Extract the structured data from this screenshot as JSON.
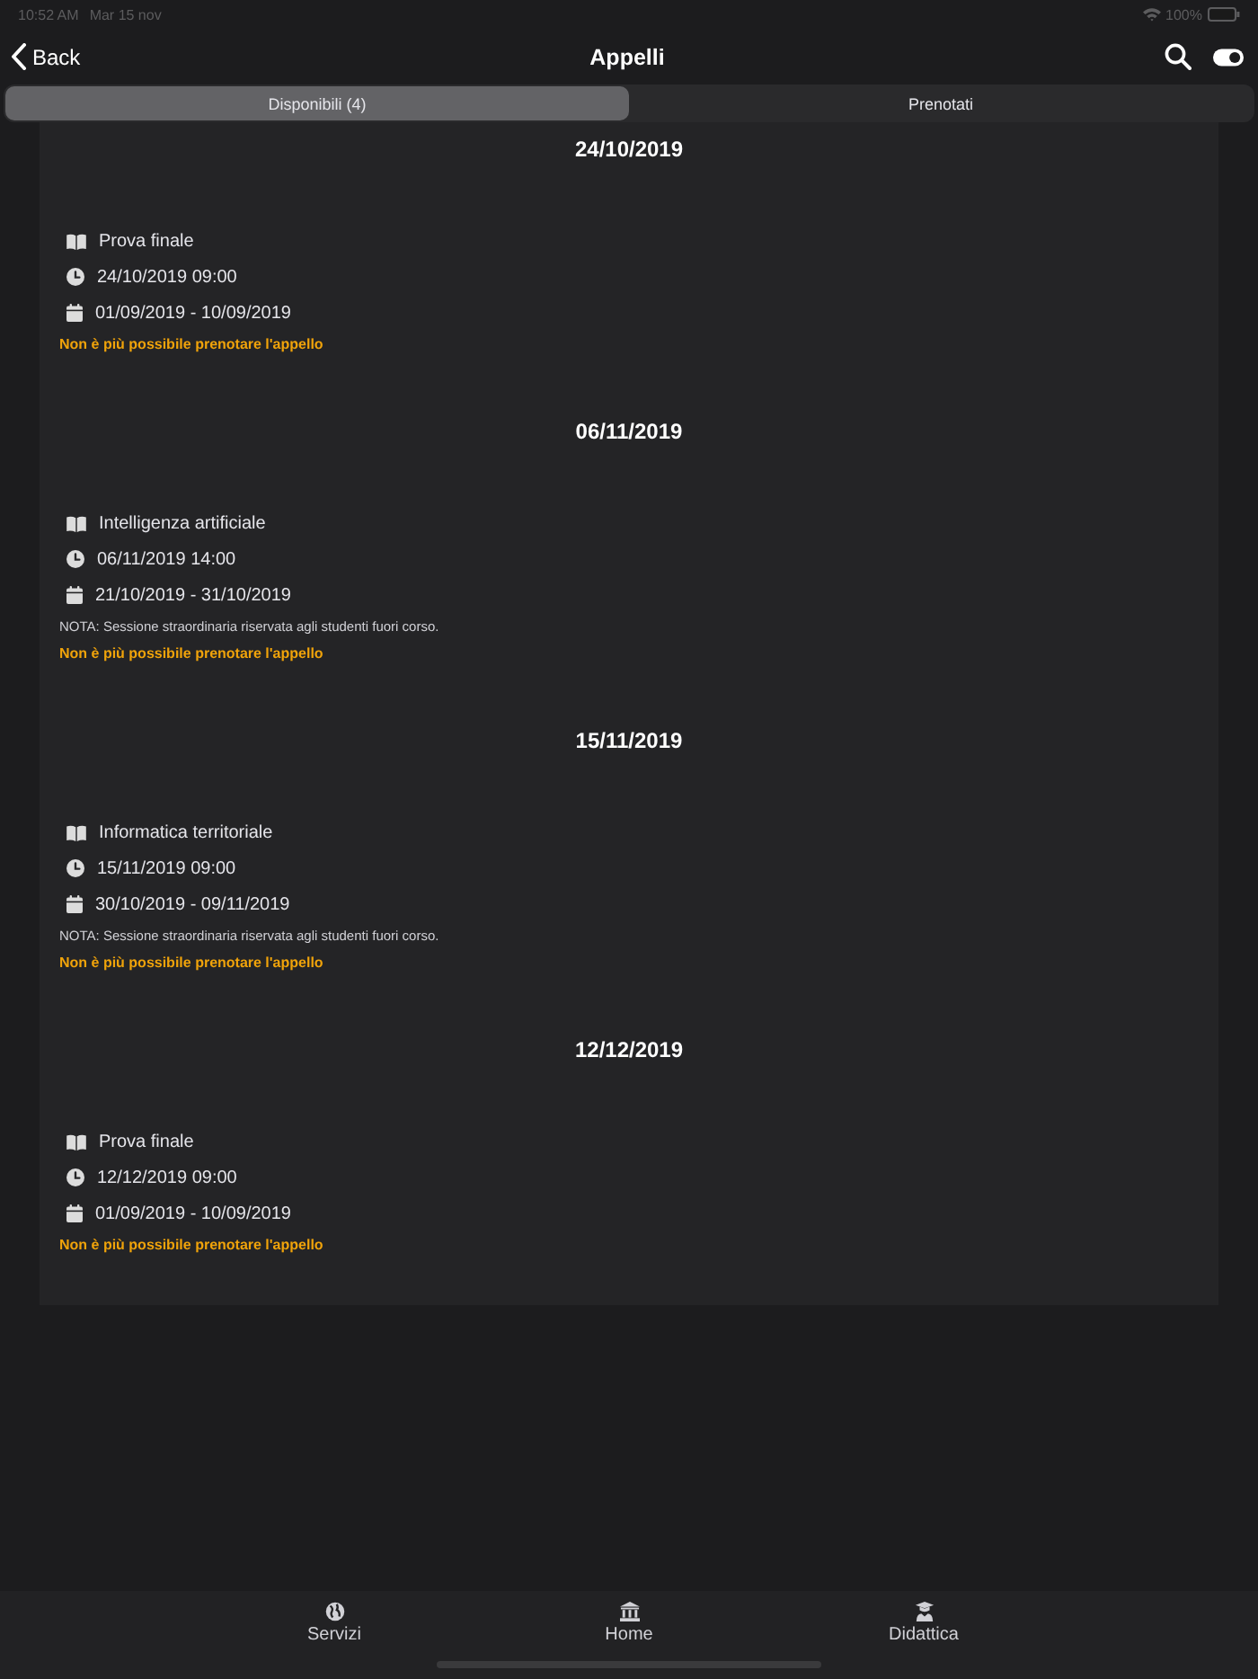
{
  "status_bar": {
    "time": "10:52 AM",
    "date": "Mar 15 nov",
    "battery": "100%"
  },
  "nav_bar": {
    "back": "Back",
    "title": "Appelli"
  },
  "tabs": [
    {
      "label": "Disponibili (4)",
      "selected": true
    },
    {
      "label": "Prenotati",
      "selected": false
    }
  ],
  "exams": [
    {
      "date": "24/10/2019",
      "course": "Prova finale",
      "time": "24/10/2019 09:00",
      "period": "01/09/2019 - 10/09/2019",
      "warning": "Non è più possibile prenotare l'appello"
    },
    {
      "date": "06/11/2019",
      "course": "Intelligenza artificiale",
      "time": "06/11/2019 14:00",
      "period": "21/10/2019 - 31/10/2019",
      "note": "NOTA: Sessione straordinaria riservata agli studenti fuori corso.",
      "warning": "Non è più possibile prenotare l'appello"
    },
    {
      "date": "15/11/2019",
      "course": "Informatica territoriale",
      "time": "15/11/2019 09:00",
      "period": "30/10/2019 - 09/11/2019",
      "note": "NOTA: Sessione straordinaria riservata agli studenti fuori corso.",
      "warning": "Non è più possibile prenotare l'appello"
    },
    {
      "date": "12/12/2019",
      "course": "Prova finale",
      "time": "12/12/2019 09:00",
      "period": "01/09/2019 - 10/09/2019",
      "warning": "Non è più possibile prenotare l'appello"
    }
  ],
  "tab_bar": [
    {
      "label": "Servizi",
      "selected": false
    },
    {
      "label": "Home",
      "selected": false
    },
    {
      "label": "Didattica",
      "selected": false
    }
  ]
}
